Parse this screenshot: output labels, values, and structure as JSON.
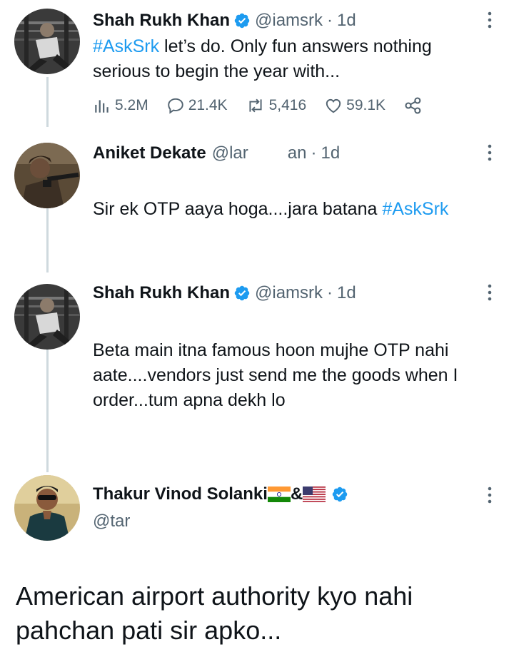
{
  "tweets": [
    {
      "name": "Shah Rukh Khan",
      "handle": "@iamsrk",
      "time": "1d",
      "text_hashtag": "#AskSrk",
      "text": " let’s do. Only fun answers nothing serious to begin the year with...",
      "stats": {
        "views": "5.2M",
        "replies": "21.4K",
        "retweets": "5,416",
        "likes": "59.1K"
      }
    },
    {
      "name": "Aniket Dekate",
      "handle": "@lar",
      "time_partial": "an",
      "time": "1d",
      "text": "Sir ek OTP aaya hoga....jara batana ",
      "text_hashtag": "#AskSrk"
    },
    {
      "name": "Shah Rukh Khan",
      "handle": "@iamsrk",
      "time": "1d",
      "text": "Beta main itna famous hoon mujhe OTP nahi aate....vendors just send me the goods when I order...tum apna dekh lo"
    },
    {
      "name": "Thakur Vinod Solanki",
      "name_suffix": "&",
      "handle": "@tar"
    }
  ],
  "caption": "American airport authority kyo nahi pahchan pati sir apko...",
  "colors": {
    "accent": "#1d9bf0",
    "muted": "#536471",
    "thread_line": "#cfd9de"
  },
  "icons": [
    "verified-badge-icon",
    "more-icon",
    "views-icon",
    "reply-icon",
    "retweet-icon",
    "like-icon",
    "share-icon",
    "india-flag-icon",
    "us-flag-icon"
  ]
}
